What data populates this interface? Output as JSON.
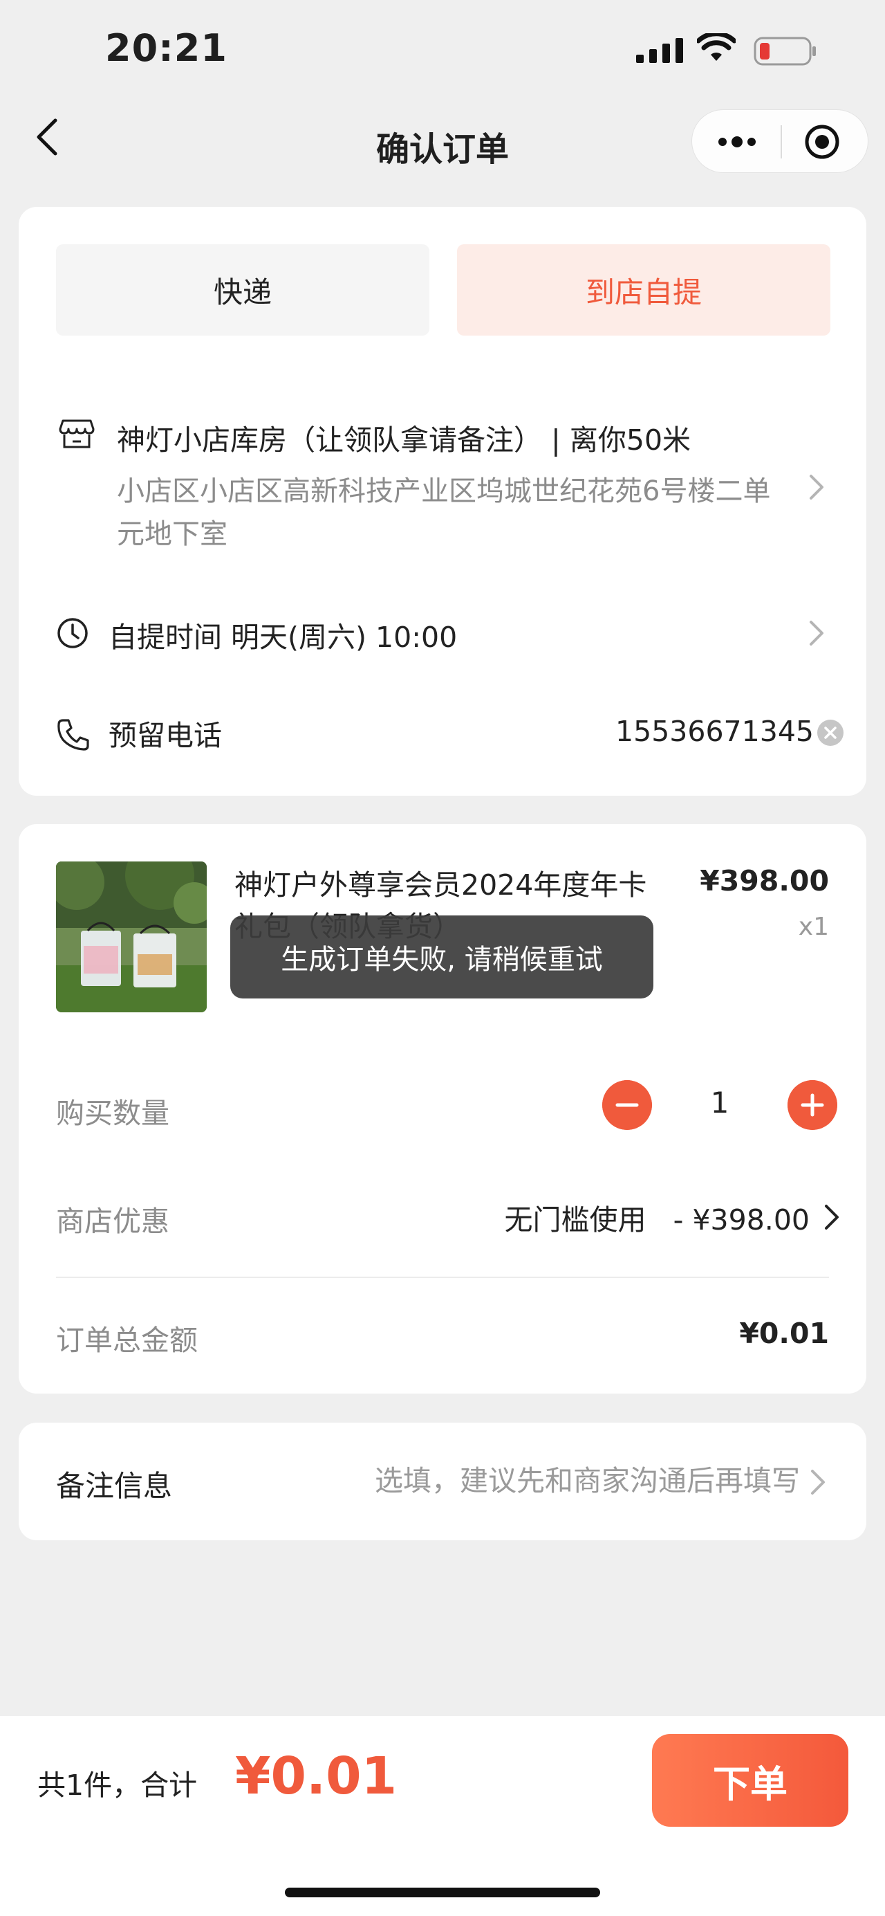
{
  "status_bar": {
    "time": "20:21"
  },
  "nav": {
    "title": "确认订单"
  },
  "delivery": {
    "tabs": [
      {
        "label": "快递"
      },
      {
        "label": "到店自提"
      }
    ],
    "selected_tab": "到店自提",
    "store_name": "神灯小店库房（让领队拿请备注） | 离你50米",
    "store_address": "小店区小店区高新科技产业区坞城世纪花苑6号楼二单元地下室",
    "pickup_time": "自提时间 明天(周六) 10:00",
    "phone_label": "预留电话",
    "phone_value": "15536671345"
  },
  "product": {
    "name": "神灯户外尊享会员2024年度年卡",
    "name_partial_line": "礼包（领队拿货）",
    "price": "¥398.00",
    "quantity_text": "x1"
  },
  "order": {
    "quantity_label": "购买数量",
    "quantity_value": "1",
    "discount_label": "商店优惠",
    "discount_text": "无门槛使用   - ¥398.00",
    "total_label": "订单总金额",
    "total_value": "¥0.01"
  },
  "remark": {
    "label": "备注信息",
    "placeholder": "选填，建议先和商家沟通后再填写"
  },
  "toast": {
    "message": "生成订单失败, 请稍候重试"
  },
  "bottom": {
    "count_text": "共1件，合计",
    "sum_price": "¥0.01",
    "submit_label": "下单"
  },
  "colors": {
    "accent": "#f05a3c",
    "tab_selected_bg": "#fdece7",
    "page_bg": "#efefef"
  }
}
